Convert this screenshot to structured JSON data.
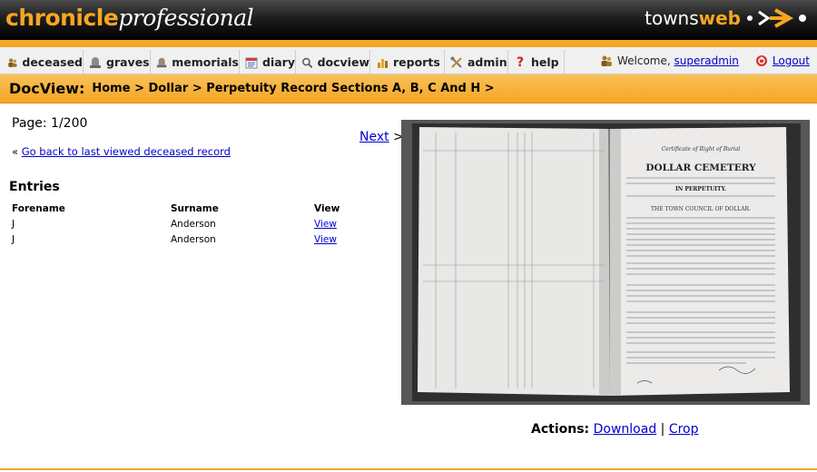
{
  "header": {
    "logo_part1": "chronicle",
    "logo_part2": "professional",
    "brand_part1": "towns",
    "brand_part2": "web"
  },
  "nav": {
    "items": [
      {
        "label": "deceased",
        "icon": "people-icon"
      },
      {
        "label": "graves",
        "icon": "grave-icon"
      },
      {
        "label": "memorials",
        "icon": "memorial-icon"
      },
      {
        "label": "diary",
        "icon": "calendar-icon"
      },
      {
        "label": "docview",
        "icon": "magnifier-icon"
      },
      {
        "label": "reports",
        "icon": "bar-chart-icon"
      },
      {
        "label": "admin",
        "icon": "tools-icon"
      },
      {
        "label": "help",
        "icon": "question-icon"
      }
    ],
    "welcome_text": "Welcome,",
    "username": "superadmin",
    "logout": "Logout"
  },
  "titlebar": {
    "title": "DocView:",
    "breadcrumb": "Home > Dollar > Perpetuity Record Sections A, B, C And H >"
  },
  "main": {
    "page_label": "Page: 1/200",
    "back_prefix": "«",
    "back_link": "Go back to last viewed deceased record",
    "next_link": "Next",
    "next_suffix": ">",
    "entries_heading": "Entries",
    "table": {
      "headers": [
        "Forename",
        "Surname",
        "View"
      ],
      "rows": [
        {
          "forename": "J",
          "surname": "Anderson",
          "view": "View"
        },
        {
          "forename": "J",
          "surname": "Anderson",
          "view": "View"
        }
      ]
    },
    "document": {
      "certificate_title": "Certificate of Right of Burial",
      "cemetery": "DOLLAR CEMETERY",
      "perpetuity": "IN PERPETUITY.",
      "council": "THE TOWN COUNCIL OF DOLLAR."
    },
    "actions_label": "Actions:",
    "download": "Download",
    "separator": "|",
    "crop": "Crop"
  },
  "colors": {
    "accent": "#f5a623",
    "link": "#0000cc",
    "header_bg": "#000000"
  }
}
